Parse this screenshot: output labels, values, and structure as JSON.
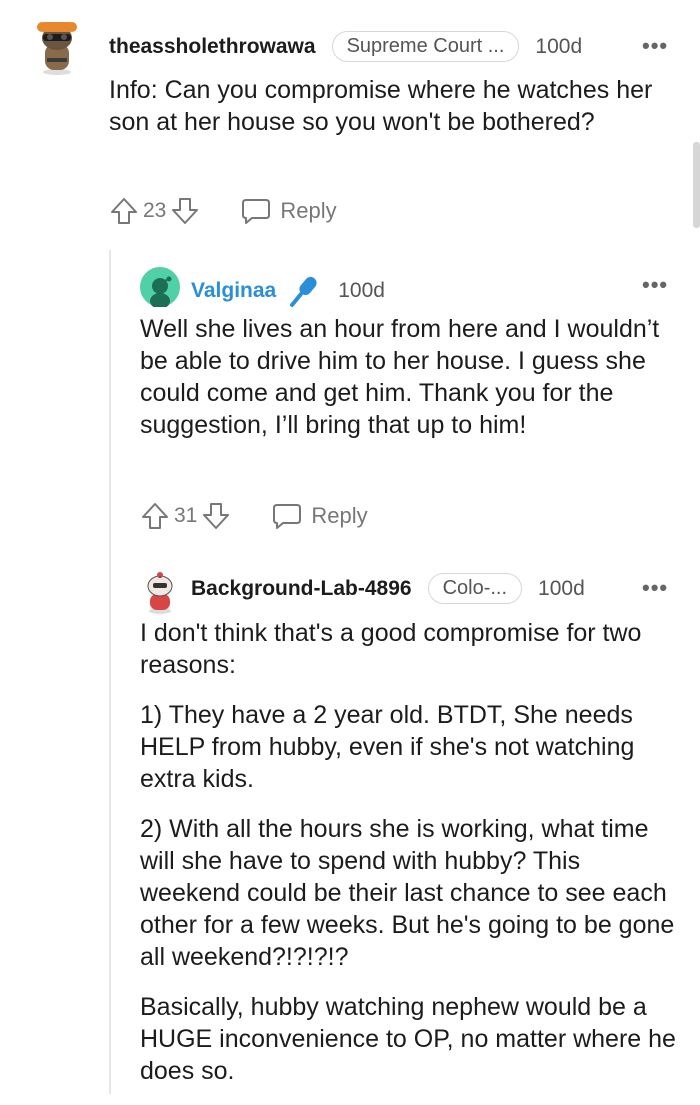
{
  "comments": [
    {
      "username": "theassholethrowawa",
      "flair": "Supreme Court ...",
      "age": "100d",
      "paragraphs": [
        "Info: Can you compromise where he watches her son at her house so you won't be bothered?"
      ],
      "votes": "23",
      "reply_label": "Reply"
    },
    {
      "username": "Valginaa",
      "age": "100d",
      "paragraphs": [
        "Well she lives an hour from here and I wouldn’t be able to drive him to her house. I guess she could come and get him. Thank you for the suggestion, I’ll bring that up to him!"
      ],
      "votes": "31",
      "reply_label": "Reply"
    },
    {
      "username": "Background-Lab-4896",
      "flair": "Colo-...",
      "age": "100d",
      "paragraphs": [
        "I don't think that's a good compromise for two reasons:",
        "1) They have a 2 year old. BTDT, She needs HELP from hubby, even if she's not watching extra kids.",
        "2) With all the hours she is working, what time will she have to spend with hubby? This weekend could be their last chance to see each other for a few weeks. But he's going to be gone all weekend?!?!?!?",
        "Basically, hubby watching nephew would be a HUGE inconvenience to OP, no matter where he does so."
      ]
    }
  ],
  "icons": {
    "more": "more-options-icon",
    "upvote": "upvote-arrow-icon",
    "downvote": "downvote-arrow-icon",
    "reply": "reply-bubble-icon",
    "mic": "microphone-icon"
  },
  "colors": {
    "op_username": "#2a8ed9",
    "mic_badge": "#2a8ed9",
    "valginaa_avatar": "#4fd0a6"
  }
}
